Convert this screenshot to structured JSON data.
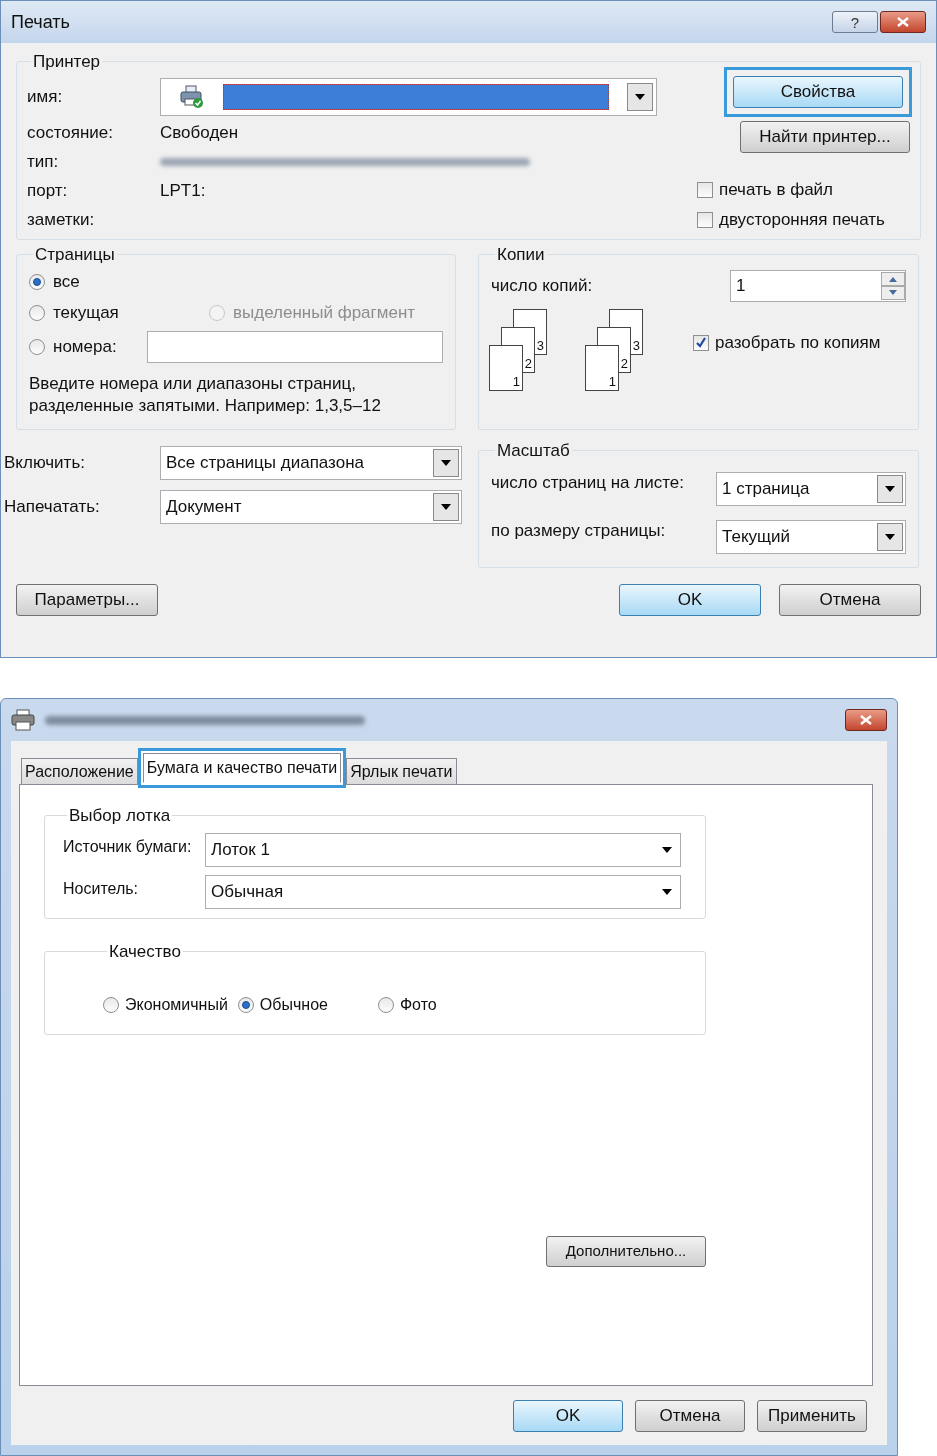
{
  "print_dialog": {
    "title": "Печать",
    "help_button": "?",
    "printer": {
      "title": "Принтер",
      "fields": [
        {
          "label": "имя:",
          "kind": "select"
        },
        {
          "label": "состояние:",
          "kind": "text",
          "value": "Свободен"
        },
        {
          "label": "тип:",
          "kind": "blurred"
        },
        {
          "label": "порт:",
          "kind": "text",
          "value": "LPT1:"
        },
        {
          "label": "заметки:",
          "kind": "empty"
        }
      ],
      "buttons": [
        {
          "label": "Свойства",
          "highlighted": true
        },
        {
          "label": "Найти принтер...",
          "highlighted": false
        }
      ],
      "checkboxes": [
        {
          "label": "печать в файл",
          "checked": false
        },
        {
          "label": "двусторонняя печать",
          "checked": false
        }
      ]
    },
    "pages": {
      "title": "Страницы",
      "options": [
        {
          "label": "все",
          "selected": true,
          "disabled": false
        },
        {
          "label": "текущая",
          "selected": false,
          "disabled": false
        },
        {
          "label": "выделенный фрагмент",
          "selected": false,
          "disabled": true
        },
        {
          "label": "номера:",
          "selected": false,
          "disabled": false
        }
      ],
      "hint": "Введите номера или диапазоны страниц,\nразделенные запятыми. Например: 1,3,5–12"
    },
    "copies": {
      "title": "Копии",
      "count_label": "число копий:",
      "count": "1",
      "stacks": [
        [
          "3",
          "2",
          "1"
        ],
        [
          "3",
          "2",
          "1"
        ]
      ],
      "collate": {
        "label": "разобрать по копиям",
        "checked": true
      }
    },
    "selects": [
      {
        "label": "Включить:",
        "value": "Все страницы диапазона"
      },
      {
        "label": "Напечатать:",
        "value": "Документ"
      }
    ],
    "scale": {
      "title": "Масштаб",
      "rows": [
        {
          "label": "число страниц на листе:",
          "value": "1 страница"
        },
        {
          "label": "по размеру страницы:",
          "value": "Текущий"
        }
      ]
    },
    "buttons": [
      {
        "label": "Параметры...",
        "default": false
      },
      {
        "label": "OK",
        "default": true
      },
      {
        "label": "Отмена",
        "default": false
      }
    ]
  },
  "properties_dialog": {
    "tabs": [
      {
        "label": "Расположение",
        "selected": false,
        "highlighted": false
      },
      {
        "label": "Бумага и качество печати",
        "selected": true,
        "highlighted": true
      },
      {
        "label": "Ярлык печати",
        "selected": false,
        "highlighted": false
      }
    ],
    "tray": {
      "title": "Выбор лотка",
      "rows": [
        {
          "label": "Источник бумаги:",
          "value": "Лоток 1"
        },
        {
          "label": "Носитель:",
          "value": "Обычная"
        }
      ]
    },
    "quality": {
      "title": "Качество",
      "options": [
        {
          "label": "Экономичный",
          "selected": false
        },
        {
          "label": "Обычное",
          "selected": true
        },
        {
          "label": "Фото",
          "selected": false
        }
      ]
    },
    "advanced_button": "Дополнительно...",
    "buttons": [
      {
        "label": "OK",
        "default": true
      },
      {
        "label": "Отмена",
        "default": false
      },
      {
        "label": "Применить",
        "default": false
      }
    ]
  }
}
